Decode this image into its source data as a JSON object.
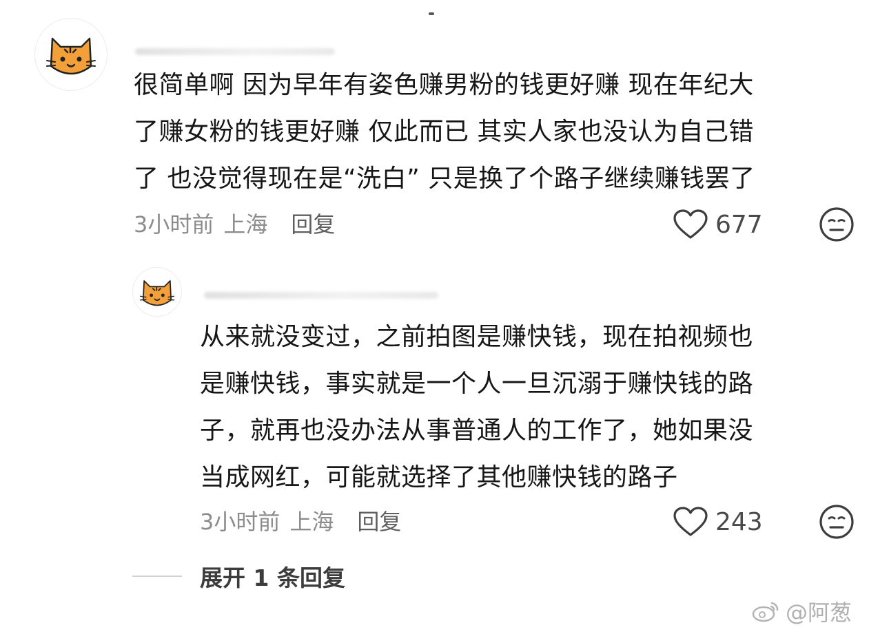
{
  "comments": [
    {
      "text": "很简单啊 因为早年有姿色赚男粉的钱更好赚 现在年纪大\n了赚女粉的钱更好赚 仅此而已 其实人家也没认为自己错\n了 也没觉得现在是“洗白” 只是换了个路子继续赚钱罢了",
      "time": "3小时前",
      "location": "上海",
      "reply_label": "回复",
      "likes": "677",
      "avatar_icon": "cat-avatar-icon"
    },
    {
      "text": "从来就没变过，之前拍图是赚快钱，现在拍视频也\n是赚快钱，事实就是一个人一旦沉溺于赚快钱的路\n子，就再也没办法从事普通人的工作了，她如果没\n当成网红，可能就选择了其他赚快钱的路子",
      "time": "3小时前",
      "location": "上海",
      "reply_label": "回复",
      "likes": "243",
      "avatar_icon": "cat-avatar-icon"
    }
  ],
  "expand_label": "展开 1 条回复",
  "watermark": "@阿葱",
  "colors": {
    "avatar_orange": "#f4a03a",
    "text": "#161616",
    "meta": "#8c8c8c"
  }
}
